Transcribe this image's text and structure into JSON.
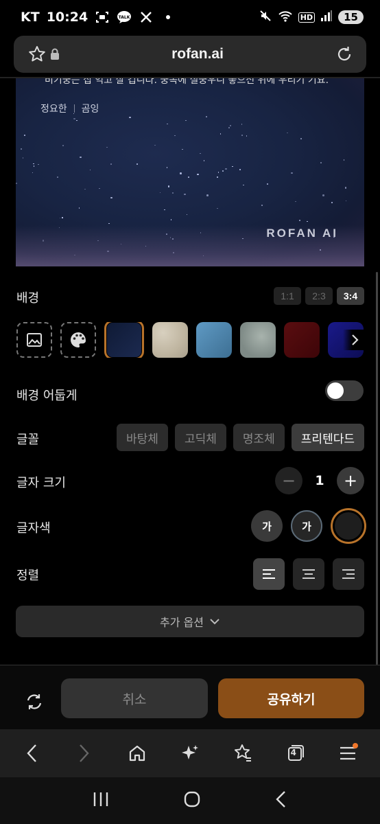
{
  "status_bar": {
    "carrier": "KT",
    "time": "10:24",
    "hd_label": "HD",
    "battery": "15"
  },
  "url_bar": {
    "url": "rofan.ai"
  },
  "preview": {
    "cut_text": "비기궁는 집 억고 살 겁니다. 궁녹에 실궁우니 좋으신 위에 우리기 기요.",
    "tag_1": "정요한",
    "tag_2": "곰잉",
    "brand": "ROFAN AI"
  },
  "background": {
    "label": "배경",
    "ratios": [
      "1:1",
      "2:3",
      "3:4"
    ],
    "selected_ratio": "3:4"
  },
  "dim_background": {
    "label": "배경 어둡게",
    "enabled": false
  },
  "font": {
    "label": "글꼴",
    "options": [
      "바탕체",
      "고딕체",
      "명조체",
      "프리텐다드"
    ],
    "selected": "프리텐다드"
  },
  "font_size": {
    "label": "글자 크기",
    "value": "1",
    "minus": "−",
    "plus": "+"
  },
  "text_color": {
    "label": "글자색",
    "chip_text": "가"
  },
  "alignment": {
    "label": "정렬",
    "selected": "left"
  },
  "more_options": {
    "label": "추가 옵션"
  },
  "actions": {
    "cancel": "취소",
    "share": "공유하기"
  },
  "browser_toolbar": {
    "tab_count": "4"
  },
  "colors": {
    "accent": "#b8732a",
    "share_button": "#8a4e17"
  }
}
